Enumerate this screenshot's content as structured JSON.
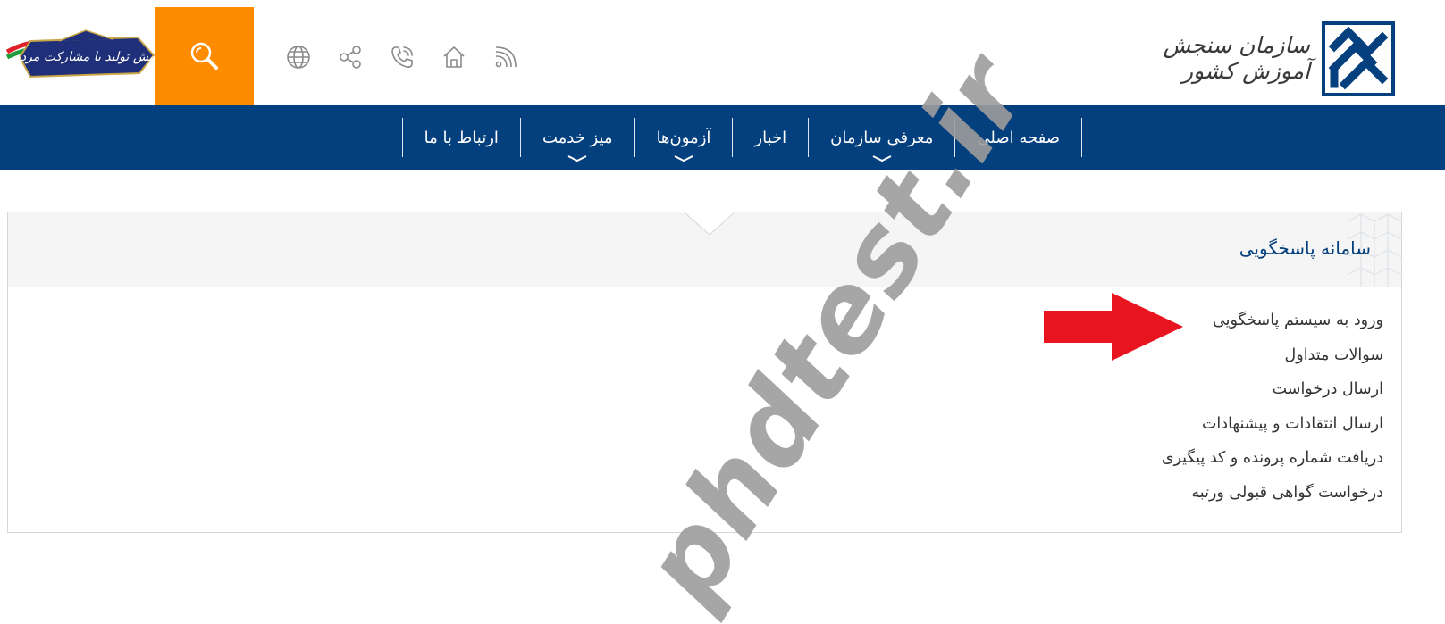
{
  "header": {
    "logo_text": "سازمان سنجش آموزش کشور",
    "slogan": "جهش تولید با مشارکت مردم",
    "tool_icons": [
      "globe-icon",
      "share-icon",
      "phone-icon",
      "home-icon",
      "rss-icon"
    ],
    "search_icon": "search-icon"
  },
  "nav": {
    "items": [
      {
        "label": "صفحه اصلی",
        "has_dropdown": false
      },
      {
        "label": "معرفی سازمان",
        "has_dropdown": true
      },
      {
        "label": "اخبار",
        "has_dropdown": false
      },
      {
        "label": "آزمون‌ها",
        "has_dropdown": true
      },
      {
        "label": "میز خدمت",
        "has_dropdown": true
      },
      {
        "label": "ارتباط با ما",
        "has_dropdown": false
      }
    ]
  },
  "panel": {
    "title": "سامانه پاسخگویی",
    "links": [
      "ورود به سیستم پاسخگویی",
      "سوالات متداول",
      "ارسال درخواست",
      "ارسال انتقادات و پیشنهادات",
      "دریافت شماره پرونده و کد پیگیری",
      "درخواست گواهی قبولی ورتبه"
    ]
  },
  "watermark": "phdtest.ir",
  "colors": {
    "nav_bg": "#043f7e",
    "search_bg": "#ff8c00",
    "arrow": "#e8141f",
    "title": "#043f7e"
  }
}
